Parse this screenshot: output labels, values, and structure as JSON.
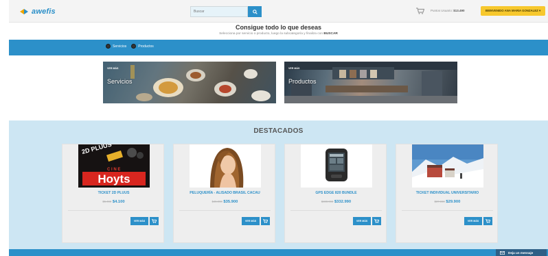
{
  "header": {
    "logo_text": "awefis",
    "search": {
      "placeholder": "Buscar",
      "value": ""
    },
    "points_label": "Puntos Usuario:",
    "points_value": "$13.490",
    "welcome_label": "BIENVENIDO ANA MARIA GONZALEZ ▾",
    "colors": {
      "accent": "#2c90c9",
      "welcome": "#f7c82d",
      "logo_orange": "#f0a500"
    }
  },
  "hero": {
    "title": "Consigue todo lo que deseas",
    "subtitle_prefix": "Selecciona por servicio o producto, luego la subcategoría y finaliza con ",
    "subtitle_bold": "BUSCAR"
  },
  "filters": [
    {
      "label": "Servicios"
    },
    {
      "label": "Productos"
    }
  ],
  "categories": [
    {
      "kicker": "VER MÁS",
      "title": "Servicios"
    },
    {
      "kicker": "VER MÁS",
      "title": "Productos"
    }
  ],
  "featured": {
    "heading": "DESTACADOS",
    "products": [
      {
        "name": "TICKET 2D PLUUS",
        "old_price": "$5.490",
        "price": "$4.100",
        "more_label": "VER MÁS",
        "image": "hoyts-ticket"
      },
      {
        "name": "PELUQUERÍA - ALISADO BRASIL CACAU",
        "old_price": "$45.990",
        "price": "$35.900",
        "more_label": "VER MÁS",
        "image": "hair-model"
      },
      {
        "name": "GPS EDGE 820 BUNDLE",
        "old_price": "$400.990",
        "price": "$332.990",
        "more_label": "VER MÁS",
        "image": "gps-device"
      },
      {
        "name": "TICKET INDIVIDUAL UNIVERSITARIO",
        "old_price": "$37.990",
        "price": "$29.900",
        "more_label": "VER MÁS",
        "image": "ski-resort"
      }
    ]
  },
  "chat": {
    "label": "Deja un mensaje"
  }
}
